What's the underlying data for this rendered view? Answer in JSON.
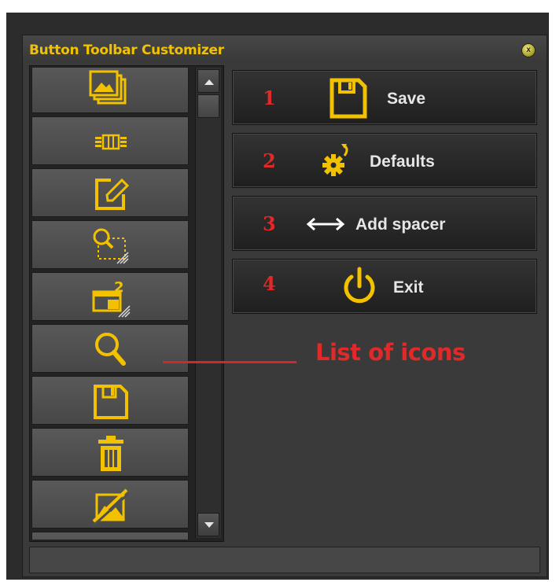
{
  "window": {
    "title": "Button Toolbar Customizer",
    "close_glyph": "x"
  },
  "icon_list": {
    "items": [
      {
        "icon": "images-icon"
      },
      {
        "icon": "filmstrip-icon"
      },
      {
        "icon": "edit-icon"
      },
      {
        "icon": "zoom-selection-icon"
      },
      {
        "icon": "second-window-icon"
      },
      {
        "icon": "magnifier-icon"
      },
      {
        "icon": "floppy-disk-icon"
      },
      {
        "icon": "trash-icon"
      },
      {
        "icon": "no-image-icon"
      }
    ]
  },
  "actions": [
    {
      "number": "1",
      "label": "Save",
      "icon": "floppy-disk-icon"
    },
    {
      "number": "2",
      "label": "Defaults",
      "icon": "gear-reset-icon"
    },
    {
      "number": "3",
      "label": "Add spacer",
      "icon": "double-arrow-icon"
    },
    {
      "number": "4",
      "label": "Exit",
      "icon": "power-icon"
    }
  ],
  "annotation": {
    "text": "List of icons"
  },
  "colors": {
    "accent_yellow": "#f2c200",
    "annotation_red": "#e02a2a",
    "panel_dark": "#2c2c2c"
  }
}
